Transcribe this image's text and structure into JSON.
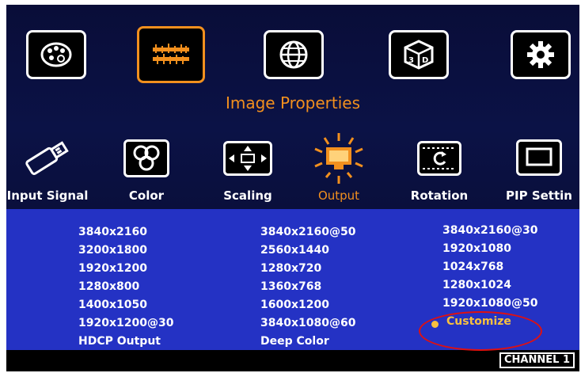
{
  "menu": {
    "title": "Image Properties",
    "top_icons": [
      {
        "name": "palette-icon",
        "selected": false
      },
      {
        "name": "image-properties-icon",
        "selected": true
      },
      {
        "name": "globe-icon",
        "selected": false
      },
      {
        "name": "3d-cube-icon",
        "selected": false
      },
      {
        "name": "gear-icon",
        "selected": false
      }
    ],
    "sub_items": [
      {
        "label": "Input Signal",
        "icon": "usb-plug-icon"
      },
      {
        "label": "Color",
        "icon": "color-circles-icon"
      },
      {
        "label": "Scaling",
        "icon": "scaling-arrows-icon"
      },
      {
        "label": "Output",
        "icon": "output-monitor-icon",
        "active": true
      },
      {
        "label": "Rotation",
        "icon": "rotation-icon"
      },
      {
        "label": "PIP Settin",
        "icon": "pip-icon"
      }
    ]
  },
  "resolutions": {
    "col1": [
      "3840x2160",
      "3200x1800",
      "1920x1200",
      "1280x800",
      "1400x1050",
      "1920x1200@30",
      "HDCP Output"
    ],
    "col2": [
      "3840x2160@50",
      "2560x1440",
      "1280x720",
      "1360x768",
      "1600x1200",
      "3840x1080@60",
      "Deep Color"
    ],
    "col3": [
      "3840x2160@30",
      "1920x1080",
      "1024x768",
      "1280x1024",
      "1920x1080@50",
      "Customize"
    ]
  },
  "status": {
    "channel": "CHANNEL 1"
  },
  "colors": {
    "accent": "#f2901e",
    "panel": "#2432c4",
    "highlight": "#f8c040",
    "annotation": "#e01010"
  }
}
